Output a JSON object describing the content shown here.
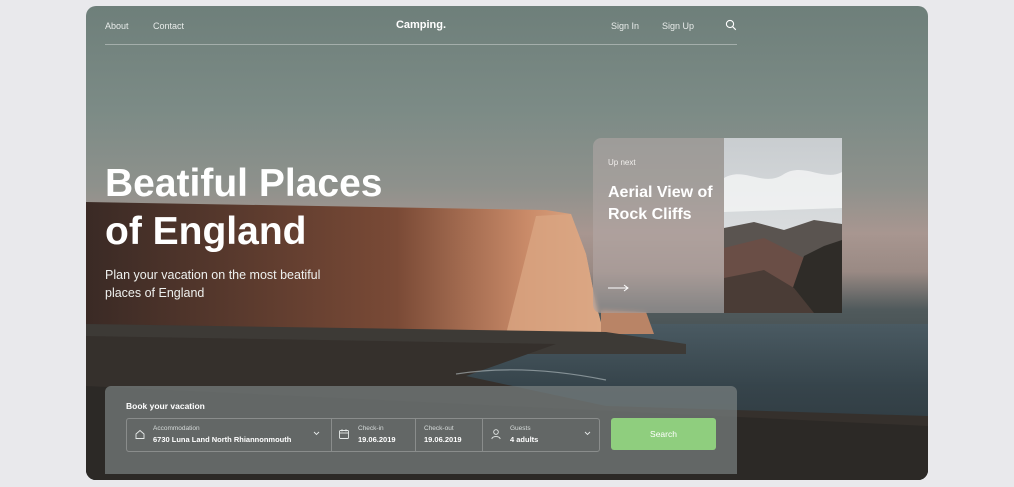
{
  "nav": {
    "links_left": [
      "About",
      "Contact"
    ],
    "brand": "Camping.",
    "links_right": [
      "Sign In",
      "Sign Up"
    ],
    "search_icon": "search-icon"
  },
  "hero": {
    "title_line1": "Beatiful Places",
    "title_line2": "of England",
    "subtitle": "Plan your vacation on the most beatiful places of England"
  },
  "next_card": {
    "kicker": "Up next",
    "title": "Aerial View of Rock Cliffs",
    "arrow_icon": "arrow-right-icon"
  },
  "booking": {
    "title": "Book your vacation",
    "accommodation": {
      "label": "Accommodation",
      "value": "6730 Luna Land North Rhiannonmouth",
      "icon": "home-icon"
    },
    "check_in": {
      "label": "Check-in",
      "value": "19.06.2019",
      "icon": "calendar-icon"
    },
    "check_out": {
      "label": "Check-out",
      "value": "19.06.2019"
    },
    "guests": {
      "label": "Guests",
      "value": "4 adults",
      "icon": "user-icon"
    },
    "search_label": "Search"
  },
  "colors": {
    "accent_green": "#8fce7e",
    "page_bg": "#e9e9ec"
  }
}
